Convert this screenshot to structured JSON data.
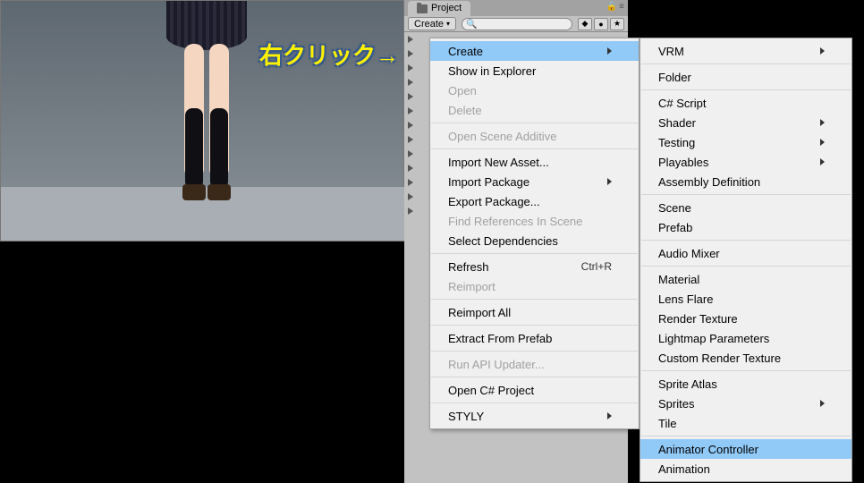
{
  "callout_text": "右クリック→",
  "project": {
    "tab_label": "Project",
    "create_label": "Create",
    "search_placeholder": ""
  },
  "menu1": {
    "create": "Create",
    "show_explorer": "Show in Explorer",
    "open": "Open",
    "delete": "Delete",
    "open_scene_additive": "Open Scene Additive",
    "import_new_asset": "Import New Asset...",
    "import_package": "Import Package",
    "export_package": "Export Package...",
    "find_refs": "Find References In Scene",
    "select_deps": "Select Dependencies",
    "refresh": "Refresh",
    "refresh_shortcut": "Ctrl+R",
    "reimport": "Reimport",
    "reimport_all": "Reimport All",
    "extract_prefab": "Extract From Prefab",
    "run_api": "Run API Updater...",
    "open_cs": "Open C# Project",
    "styly": "STYLY"
  },
  "menu2": {
    "vrm": "VRM",
    "folder": "Folder",
    "cs_script": "C# Script",
    "shader": "Shader",
    "testing": "Testing",
    "playables": "Playables",
    "assembly": "Assembly Definition",
    "scene": "Scene",
    "prefab": "Prefab",
    "audio_mixer": "Audio Mixer",
    "material": "Material",
    "lens_flare": "Lens Flare",
    "render_texture": "Render Texture",
    "lightmap": "Lightmap Parameters",
    "custom_rt": "Custom Render Texture",
    "sprite_atlas": "Sprite Atlas",
    "sprites": "Sprites",
    "tile": "Tile",
    "animator_controller": "Animator Controller",
    "animation": "Animation"
  }
}
